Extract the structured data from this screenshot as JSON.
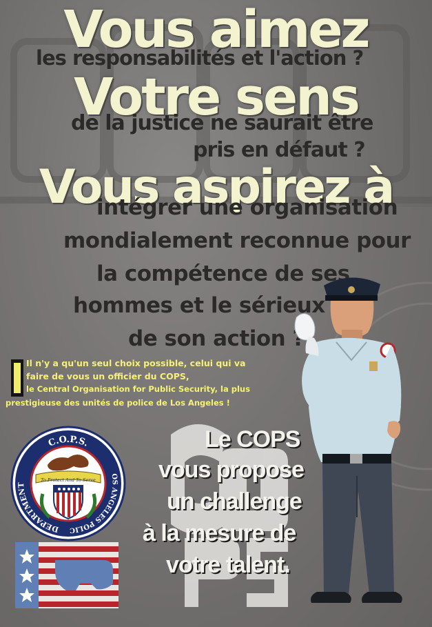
{
  "headline": {
    "line1": "Vous aimez",
    "sub1": "les responsabilités et l'action ?",
    "line2": "Votre sens",
    "sub2a": "de la justice ne saurait être",
    "sub2b": "pris en défaut ?",
    "line3": "Vous aspirez à"
  },
  "body_lines": [
    "intégrer une organisation",
    "mondialement reconnue pour",
    "la compétence de ses",
    "hommes et le sérieux",
    "de son action ?"
  ],
  "intro": {
    "line1": "Il n'y a qu'un seul choix possible, celui qui va",
    "line2": "faire de vous un officier du COPS,",
    "line3": "le Central Organisation for Public Security, la plus",
    "line4": "prestigieuse des unités de police de Los Angeles !"
  },
  "cops_lines": [
    "Le COPS",
    "vous propose",
    "un challenge",
    "à la mesure de",
    "votre talent."
  ],
  "seal": {
    "top": "C.O.P.S.",
    "left": "DEPARTMENT",
    "right": "LOS ANGELES POLICE",
    "ribbon": "To Protect And To Serve"
  },
  "colors": {
    "headline": "#f3f4cf",
    "dark_text": "#2c2a29",
    "accent_yellow": "#f6f07a",
    "background": "#6d6b6a",
    "navy": "#1c2e6e",
    "red": "#b8262c"
  }
}
